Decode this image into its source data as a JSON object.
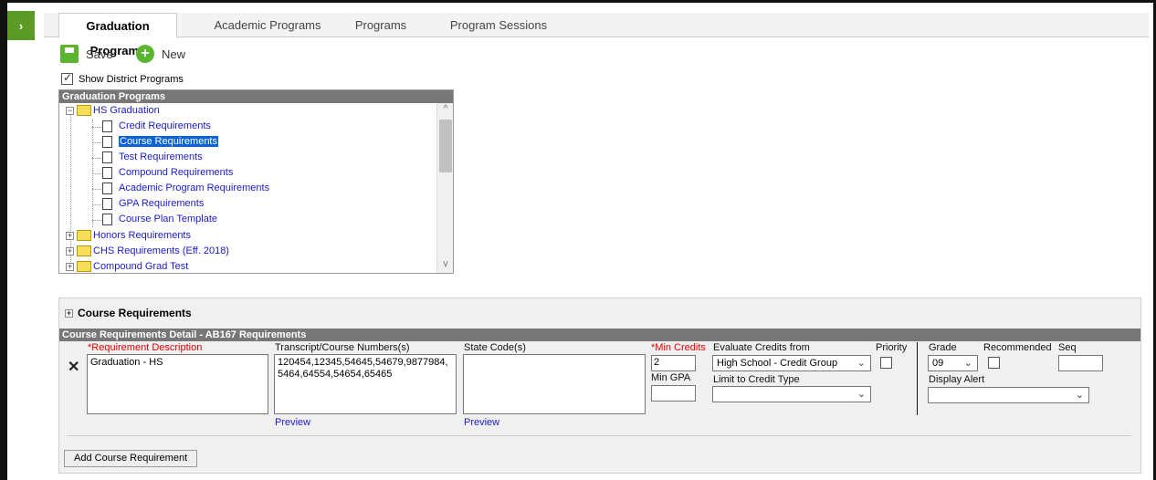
{
  "tabs": [
    {
      "label": "Graduation Programs",
      "active": true
    },
    {
      "label": "Academic Programs",
      "active": false
    },
    {
      "label": "Programs",
      "active": false
    },
    {
      "label": "Program Sessions",
      "active": false
    }
  ],
  "toolbar": {
    "save_label": "Save",
    "new_label": "New"
  },
  "show_district": {
    "label": "Show District Programs",
    "checked": true
  },
  "tree": {
    "title": "Graduation Programs",
    "items": [
      {
        "label": "HS Graduation",
        "type": "folder",
        "expanded": true
      },
      {
        "label": "Credit Requirements",
        "type": "document"
      },
      {
        "label": "Course Requirements",
        "type": "document",
        "selected": true
      },
      {
        "label": "Test Requirements",
        "type": "document"
      },
      {
        "label": "Compound Requirements",
        "type": "document"
      },
      {
        "label": "Academic Program Requirements",
        "type": "document"
      },
      {
        "label": "GPA Requirements",
        "type": "document"
      },
      {
        "label": "Course Plan Template",
        "type": "document"
      },
      {
        "label": "Honors Requirements",
        "type": "folder",
        "expanded": false
      },
      {
        "label": "CHS Requirements (Eff. 2018)",
        "type": "folder",
        "expanded": false
      },
      {
        "label": "Compound Grad Test",
        "type": "folder",
        "expanded": false
      }
    ]
  },
  "course_requirements": {
    "title": "Course Requirements",
    "detail_title": "Course Requirements Detail - AB167 Requirements",
    "requirement_description": {
      "label": "*Requirement Description",
      "value": "Graduation - HS"
    },
    "transcript_course_numbers": {
      "label": "Transcript/Course Numbers(s)",
      "value": "120454,12345,54645,54679,9877984,5464,64554,54654,65465",
      "preview_label": "Preview"
    },
    "state_codes": {
      "label": "State Code(s)",
      "value": "",
      "preview_label": "Preview"
    },
    "min_credits": {
      "label": "*Min Credits",
      "value": "2"
    },
    "min_gpa": {
      "label": "Min GPA",
      "value": ""
    },
    "evaluate_credits_from": {
      "label": "Evaluate Credits from",
      "value": "High School - Credit Group"
    },
    "limit_to_credit_type": {
      "label": "Limit to Credit Type",
      "value": ""
    },
    "priority": {
      "label": "Priority",
      "checked": false
    },
    "grade": {
      "label": "Grade",
      "value": "09"
    },
    "recommended": {
      "label": "Recommended",
      "checked": false
    },
    "seq": {
      "label": "Seq",
      "value": ""
    },
    "display_alert": {
      "label": "Display Alert",
      "value": ""
    },
    "add_button_label": "Add Course Requirement"
  },
  "icons": {
    "sidebar_toggle": "›",
    "expand": "+",
    "collapse": "−",
    "remove": "✕",
    "chevron_down": "⌄",
    "scroll_up": "^",
    "scroll_down": "v"
  },
  "colors": {
    "accent_green": "#5cb531",
    "selection_blue": "#0a63d6",
    "required_red": "#e00000"
  }
}
